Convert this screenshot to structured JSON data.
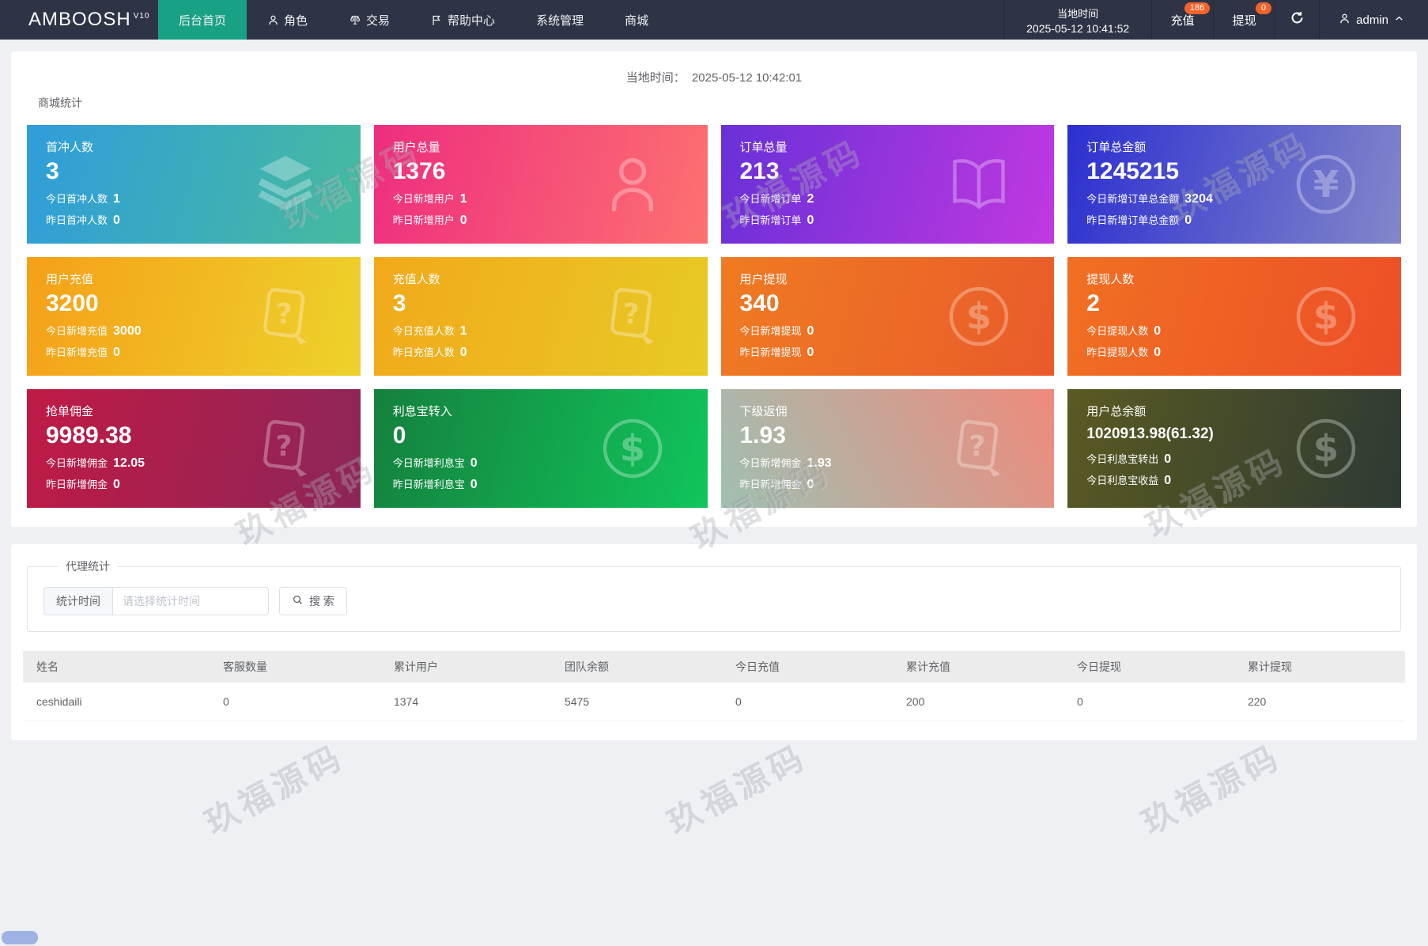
{
  "navbar": {
    "logo": "AMBOOSH",
    "logo_sup": "V10",
    "items": [
      {
        "label": "后台首页",
        "active": true
      },
      {
        "label": "角色",
        "icon": "user-icon"
      },
      {
        "label": "交易",
        "icon": "scales-icon"
      },
      {
        "label": "帮助中心",
        "icon": "flag-icon"
      },
      {
        "label": "系统管理"
      },
      {
        "label": "商城"
      }
    ],
    "local_time_label": "当地时间",
    "local_time_value": "2025-05-12 10:41:52",
    "recharge": {
      "label": "充值",
      "badge": "186"
    },
    "withdraw": {
      "label": "提现",
      "badge": "0"
    },
    "user": "admin"
  },
  "main": {
    "time_label": "当地时间：",
    "time_value": "2025-05-12 10:42:01",
    "stats_title": "商城统计"
  },
  "cards": [
    {
      "title": "首冲人数",
      "value": "3",
      "icon": "layers-icon",
      "gradient": [
        "#2f9ddb",
        "#47bb9e"
      ],
      "lines": [
        {
          "label": "今日首冲人数",
          "value": "1"
        },
        {
          "label": "昨日首冲人数",
          "value": "0"
        }
      ]
    },
    {
      "title": "用户总量",
      "value": "1376",
      "icon": "person-icon",
      "gradient": [
        "#ee2d7f",
        "#fd7170"
      ],
      "lines": [
        {
          "label": "今日新增用户",
          "value": "1"
        },
        {
          "label": "昨日新增用户",
          "value": "0"
        }
      ]
    },
    {
      "title": "订单总量",
      "value": "213",
      "icon": "book-icon",
      "gradient": [
        "#6930d8",
        "#c138e0"
      ],
      "lines": [
        {
          "label": "今日新增订单",
          "value": "2"
        },
        {
          "label": "昨日新增订单",
          "value": "0"
        }
      ]
    },
    {
      "title": "订单总金额",
      "value": "1245215",
      "icon": "yen-circle-icon",
      "gradient": [
        "#2c2fd0",
        "#8387c9"
      ],
      "lines": [
        {
          "label": "今日新增订单总金额",
          "value": "3204"
        },
        {
          "label": "昨日新增订单总金额",
          "value": "0"
        }
      ]
    },
    {
      "title": "用户充值",
      "value": "3200",
      "icon": "doc-question-icon",
      "gradient": [
        "#f5a018",
        "#edd22b"
      ],
      "lines": [
        {
          "label": "今日新增充值",
          "value": "3000"
        },
        {
          "label": "昨日新增充值",
          "value": "0"
        }
      ]
    },
    {
      "title": "充值人数",
      "value": "3",
      "icon": "doc-question-icon",
      "gradient": [
        "#f2a91b",
        "#e7ca25"
      ],
      "lines": [
        {
          "label": "今日充值人数",
          "value": "1"
        },
        {
          "label": "昨日充值人数",
          "value": "0"
        }
      ]
    },
    {
      "title": "用户提现",
      "value": "340",
      "icon": "dollar-circle-icon",
      "gradient": [
        "#ef7b22",
        "#e95b2a"
      ],
      "lines": [
        {
          "label": "今日新增提现",
          "value": "0"
        },
        {
          "label": "昨日新增提现",
          "value": "0"
        }
      ]
    },
    {
      "title": "提现人数",
      "value": "2",
      "icon": "dollar-circle-icon",
      "gradient": [
        "#f07022",
        "#ed4f27"
      ],
      "lines": [
        {
          "label": "今日提现人数",
          "value": "0"
        },
        {
          "label": "昨日提现人数",
          "value": "0"
        }
      ]
    },
    {
      "title": "抢单佣金",
      "value": "9989.38",
      "icon": "doc-question-icon",
      "gradient": [
        "#c01a45",
        "#8c2658"
      ],
      "lines": [
        {
          "label": "今日新增佣金",
          "value": "12.05"
        },
        {
          "label": "昨日新增佣金",
          "value": "0"
        }
      ]
    },
    {
      "title": "利息宝转入",
      "value": "0",
      "icon": "dollar-circle-icon",
      "gradient": [
        "#15803d",
        "#10c55c"
      ],
      "lines": [
        {
          "label": "今日新增利息宝",
          "value": "0"
        },
        {
          "label": "昨日新增利息宝",
          "value": "0"
        }
      ]
    },
    {
      "title": "下级返佣",
      "value": "1.93",
      "icon": "doc-question-icon",
      "gradient": [
        "#9fc0b1",
        "#ef8a7c"
      ],
      "lines": [
        {
          "label": "今日新增佣金",
          "value": "1.93"
        },
        {
          "label": "昨日新增佣金",
          "value": "0"
        }
      ]
    },
    {
      "title": "用户总余额",
      "value": "1020913.98(61.32)",
      "icon": "dollar-circle-icon",
      "gradient": [
        "#5a5a22",
        "#2e3a33"
      ],
      "lines": [
        {
          "label": "今日利息宝转出",
          "value": "0"
        },
        {
          "label": "今日利息宝收益",
          "value": "0"
        }
      ]
    }
  ],
  "agent": {
    "legend": "代理统计",
    "filter_label": "统计时间",
    "placeholder": "请选择统计时间",
    "search_label": "搜 索"
  },
  "table": {
    "headers": [
      "姓名",
      "客服数量",
      "累计用户",
      "团队余额",
      "今日充值",
      "累计充值",
      "今日提现",
      "累计提现"
    ],
    "rows": [
      [
        "ceshidaili",
        "0",
        "1374",
        "5475",
        "0",
        "200",
        "0",
        "220"
      ]
    ]
  },
  "watermark": "玖福源码",
  "colors": {
    "navbar_bg": "#2e3446",
    "active_menu": "#18a185",
    "badge": "#f5632a"
  }
}
